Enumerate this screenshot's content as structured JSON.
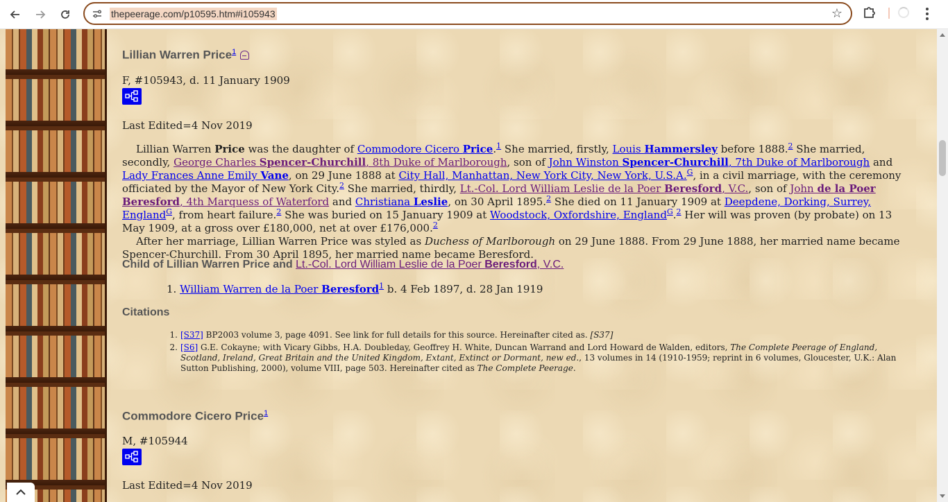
{
  "browser": {
    "url": "thepeerage.com/p10595.htm#i105943"
  },
  "person1": {
    "name": "Lillian Warren Price",
    "name_ref": "1",
    "meta": "F, #105943, d. 11 January 1909",
    "last_edited": "Last Edited=4 Nov 2019",
    "bio": {
      "p1_name_plain": "Lillian Warren ",
      "p1_name_bold": "Price",
      "t_daughter": " was the daughter of ",
      "father_pre": "Commodore Cicero ",
      "father_bold": "Price",
      "r1": "1",
      "t_married1": " She married, firstly, ",
      "husband1_pre": "Louis ",
      "husband1_bold": "Hammersley",
      "t_before": " before 1888.",
      "r2": "2",
      "t_married2": " She married, secondly, ",
      "husband2_pre": "George Charles ",
      "husband2_bold": "Spencer-Churchill",
      "husband2_post": ", 8th Duke of Marlborough",
      "t_sonof": ", son of ",
      "h2father_pre": "John Winston ",
      "h2father_bold": "Spencer-Churchill",
      "h2father_post": ", 7th Duke of Marlborough",
      "t_and": " and ",
      "h2mother_pre": "Lady Frances Anne Emily ",
      "h2mother_bold": "Vane",
      "t_on29": ", on 29 June 1888 at ",
      "place1": "City Hall, Manhattan, New York City, New York, U.S.A.",
      "g1": "G",
      "t_civil": ", in a civil marriage, with the ceremony officiated by the Mayor of New York City.",
      "r3": "2",
      "t_married3": " She married, thirdly, ",
      "husband3_pre": "Lt.-Col. Lord William Leslie de la Poer ",
      "husband3_bold": "Beresford",
      "husband3_post": ", V.C.",
      "t_sonof2": ", son of ",
      "h3father_pre": "John ",
      "h3father_bold": "de la Poer Beresford",
      "h3father_post": ", 4th Marquess of Waterford",
      "t_and2": " and ",
      "h3mother_pre": "Christiana ",
      "h3mother_bold": "Leslie",
      "t_on30": ", on 30 April 1895.",
      "r4": "2",
      "t_died": " She died on 11 January 1909 at ",
      "place2": "Deepdene, Dorking, Surrey, England",
      "g2": "G",
      "t_heart": ", from heart failure.",
      "r5": "2",
      "t_buried": " She was buried on 15 January 1909 at ",
      "place3": "Woodstock, Oxfordshire, England",
      "g3": "G",
      "t_dot": ".",
      "r6": "2",
      "t_will": " Her will was proven (by probate) on 13 May 1909, at a gross over £180,000, net at over £176,000.",
      "r7": "2",
      "p2_a": "After her marriage, Lillian Warren Price was styled as ",
      "p2_title": "Duchess of Marlborough",
      "p2_b": " on 29 June 1888. From 29 June 1888, her married name became Spencer-Churchill. From 30 April 1895, her married name became Beresford."
    },
    "children_heading_pre": "Child of Lillian Warren Price and ",
    "children_heading_link_pre": "Lt.-Col. Lord William Leslie de la Poer ",
    "children_heading_link_bold": "Beresford",
    "children_heading_link_post": ", V.C.",
    "children": [
      {
        "num": "1.",
        "name_pre": "William Warren de la Poer ",
        "name_bold": "Beresford",
        "ref": "1",
        "dates": " b. 4 Feb 1897, d. 28 Jan 1919"
      }
    ],
    "citations_heading": "Citations",
    "citations": [
      {
        "num": "1.",
        "code": "[S37]",
        "text_a": " BP2003 volume 3, page 4091. See link for full details for this source. Hereinafter cited as. ",
        "text_em": "[S37]",
        "text_b": ""
      },
      {
        "num": "2.",
        "code": "[S6]",
        "text_a": " G.E. Cokayne; with Vicary Gibbs, H.A. Doubleday, Geoffrey H. White, Duncan Warrand and Lord Howard de Walden, editors, ",
        "text_em": "The Complete Peerage of England, Scotland, Ireland, Great Britain and the United Kingdom, Extant, Extinct or Dormant, new ed.",
        "text_b": ", 13 volumes in 14 (1910-1959; reprint in 6 volumes, Gloucester, U.K.: Alan Sutton Publishing, 2000), volume VIII, page 503. Hereinafter cited as ",
        "text_em2": "The Complete Peerage",
        "text_c": "."
      }
    ]
  },
  "person2": {
    "name": "Commodore Cicero Price",
    "name_ref": "1",
    "meta": "M, #105944",
    "last_edited": "Last Edited=4 Nov 2019"
  },
  "icons": {
    "back": "back-arrow-icon",
    "forward": "forward-arrow-icon",
    "reload": "reload-icon",
    "star": "star-icon",
    "extensions": "puzzle-icon",
    "menu": "kebab-menu-icon",
    "tree": "family-tree-icon",
    "lock": "lock-icon"
  },
  "colors": {
    "link": "#0000ee",
    "visited": "#6a1b7a",
    "heading": "#555555",
    "page_bg": "#ecd9b4",
    "tree_button": "#0000f0"
  }
}
